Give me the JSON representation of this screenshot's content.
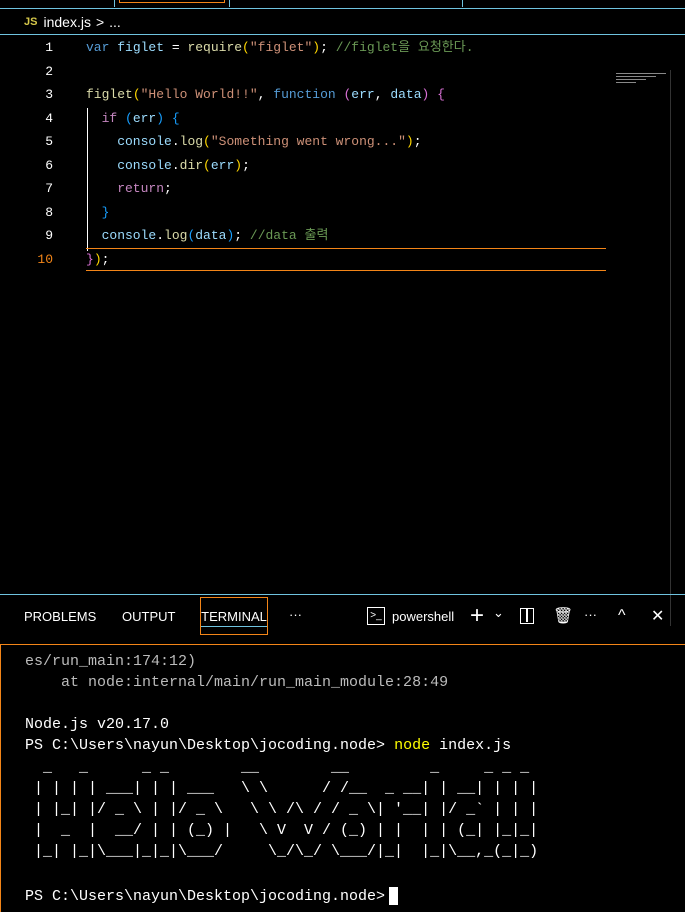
{
  "breadcrumb": {
    "lang_badge": "JS",
    "file": "index.js",
    "sep": ">",
    "more": "..."
  },
  "editor": {
    "current_line": 10,
    "lines": [
      [
        [
          "var ",
          "kw"
        ],
        [
          "figlet",
          "id"
        ],
        [
          " = ",
          "pl"
        ],
        [
          "require",
          "fn"
        ],
        [
          "(",
          "p1"
        ],
        [
          "\"figlet\"",
          "str"
        ],
        [
          ")",
          "p1"
        ],
        [
          "; ",
          "pl"
        ],
        [
          "//figlet을 요청한다.",
          "cm"
        ]
      ],
      [],
      [
        [
          "figlet",
          "fn"
        ],
        [
          "(",
          "p1"
        ],
        [
          "\"Hello World!!\"",
          "str"
        ],
        [
          ", ",
          "pl"
        ],
        [
          "function ",
          "kw"
        ],
        [
          "(",
          "p2"
        ],
        [
          "err",
          "id"
        ],
        [
          ", ",
          "pl"
        ],
        [
          "data",
          "id"
        ],
        [
          ")",
          "p2"
        ],
        [
          " {",
          "p2"
        ]
      ],
      [
        [
          "  if ",
          "ctl"
        ],
        [
          "(",
          "p3"
        ],
        [
          "err",
          "id"
        ],
        [
          ") ",
          "p3"
        ],
        [
          "{",
          "p3"
        ]
      ],
      [
        [
          "    console",
          "id"
        ],
        [
          ".",
          "pl"
        ],
        [
          "log",
          "fn"
        ],
        [
          "(",
          "p1"
        ],
        [
          "\"Something went wrong...\"",
          "str"
        ],
        [
          ")",
          "p1"
        ],
        [
          ";",
          "pl"
        ]
      ],
      [
        [
          "    console",
          "id"
        ],
        [
          ".",
          "pl"
        ],
        [
          "dir",
          "fn"
        ],
        [
          "(",
          "p1"
        ],
        [
          "err",
          "id"
        ],
        [
          ")",
          "p1"
        ],
        [
          ";",
          "pl"
        ]
      ],
      [
        [
          "    return",
          "ctl"
        ],
        [
          ";",
          "pl"
        ]
      ],
      [
        [
          "  }",
          "p3"
        ]
      ],
      [
        [
          "  console",
          "id"
        ],
        [
          ".",
          "pl"
        ],
        [
          "log",
          "fn"
        ],
        [
          "(",
          "p3"
        ],
        [
          "data",
          "id"
        ],
        [
          ")",
          "p3"
        ],
        [
          "; ",
          "pl"
        ],
        [
          "//data 출력",
          "cm"
        ]
      ],
      [
        [
          "}",
          "p2"
        ],
        [
          ")",
          "p1"
        ],
        [
          ";",
          "pl"
        ]
      ]
    ]
  },
  "panel": {
    "tabs": [
      "PROBLEMS",
      "OUTPUT",
      "TERMINAL"
    ],
    "active_tab": "TERMINAL",
    "more": "···",
    "terminal_name": "powershell",
    "actions": {
      "add": "+",
      "dropdown": "⌄",
      "split": "◫",
      "trash": "🗑",
      "more": "···",
      "maximize": "^",
      "close": "✕"
    }
  },
  "terminal": {
    "lines": [
      {
        "text": "es/run_main:174:12)",
        "style": "dim"
      },
      {
        "text": "    at node:internal/main/run_main_module:28:49",
        "style": "dim"
      },
      {
        "text": "",
        "style": ""
      },
      {
        "text": "Node.js v20.17.0",
        "style": ""
      }
    ],
    "prompt": "PS C:\\Users\\nayun\\Desktop\\jocoding.node> ",
    "command": "node",
    "args": " index.js",
    "ascii_art": "  _   _      _ _        __        __         _     _ _ _ \n | | | | ___| | | ___   \\ \\      / /__  _ __| | __| | | |\n | |_| |/ _ \\ | |/ _ \\   \\ \\ /\\ / / _ \\| '__| |/ _` | | |\n |  _  |  __/ | | (_) |   \\ V  V / (_) | |  | | (_| |_|_|\n |_| |_|\\___|_|_|\\___/     \\_/\\_/ \\___/|_|  |_|\\__,_(_|_)",
    "final_prompt": "PS C:\\Users\\nayun\\Desktop\\jocoding.node>"
  }
}
